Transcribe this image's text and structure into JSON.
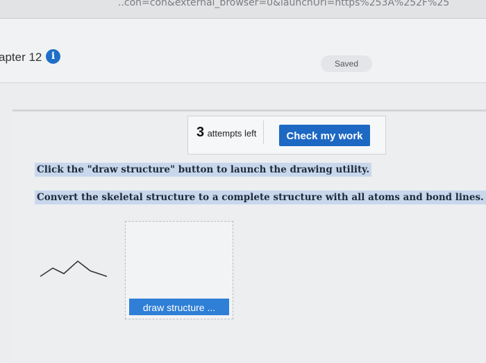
{
  "browser": {
    "url_fragment": "..con=con&external_browser=0&launchUrl=https%253A%252F%25"
  },
  "header": {
    "chapter_label": "apter 12",
    "info_icon": "info-icon",
    "saved_label": "Saved"
  },
  "attempts": {
    "count": "3",
    "label": "attempts left",
    "check_button_label": "Check my work"
  },
  "instructions": {
    "line1": "Click the \"draw structure\" button to launch the drawing utility.",
    "line2": "Convert the skeletal structure to a complete structure with all atoms and bond lines."
  },
  "drawing": {
    "button_label": "draw structure ...",
    "molecule_icon": "skeletal-structure-icon"
  },
  "colors": {
    "primary_blue": "#1d68c3",
    "highlight": "#c8d7ec"
  }
}
